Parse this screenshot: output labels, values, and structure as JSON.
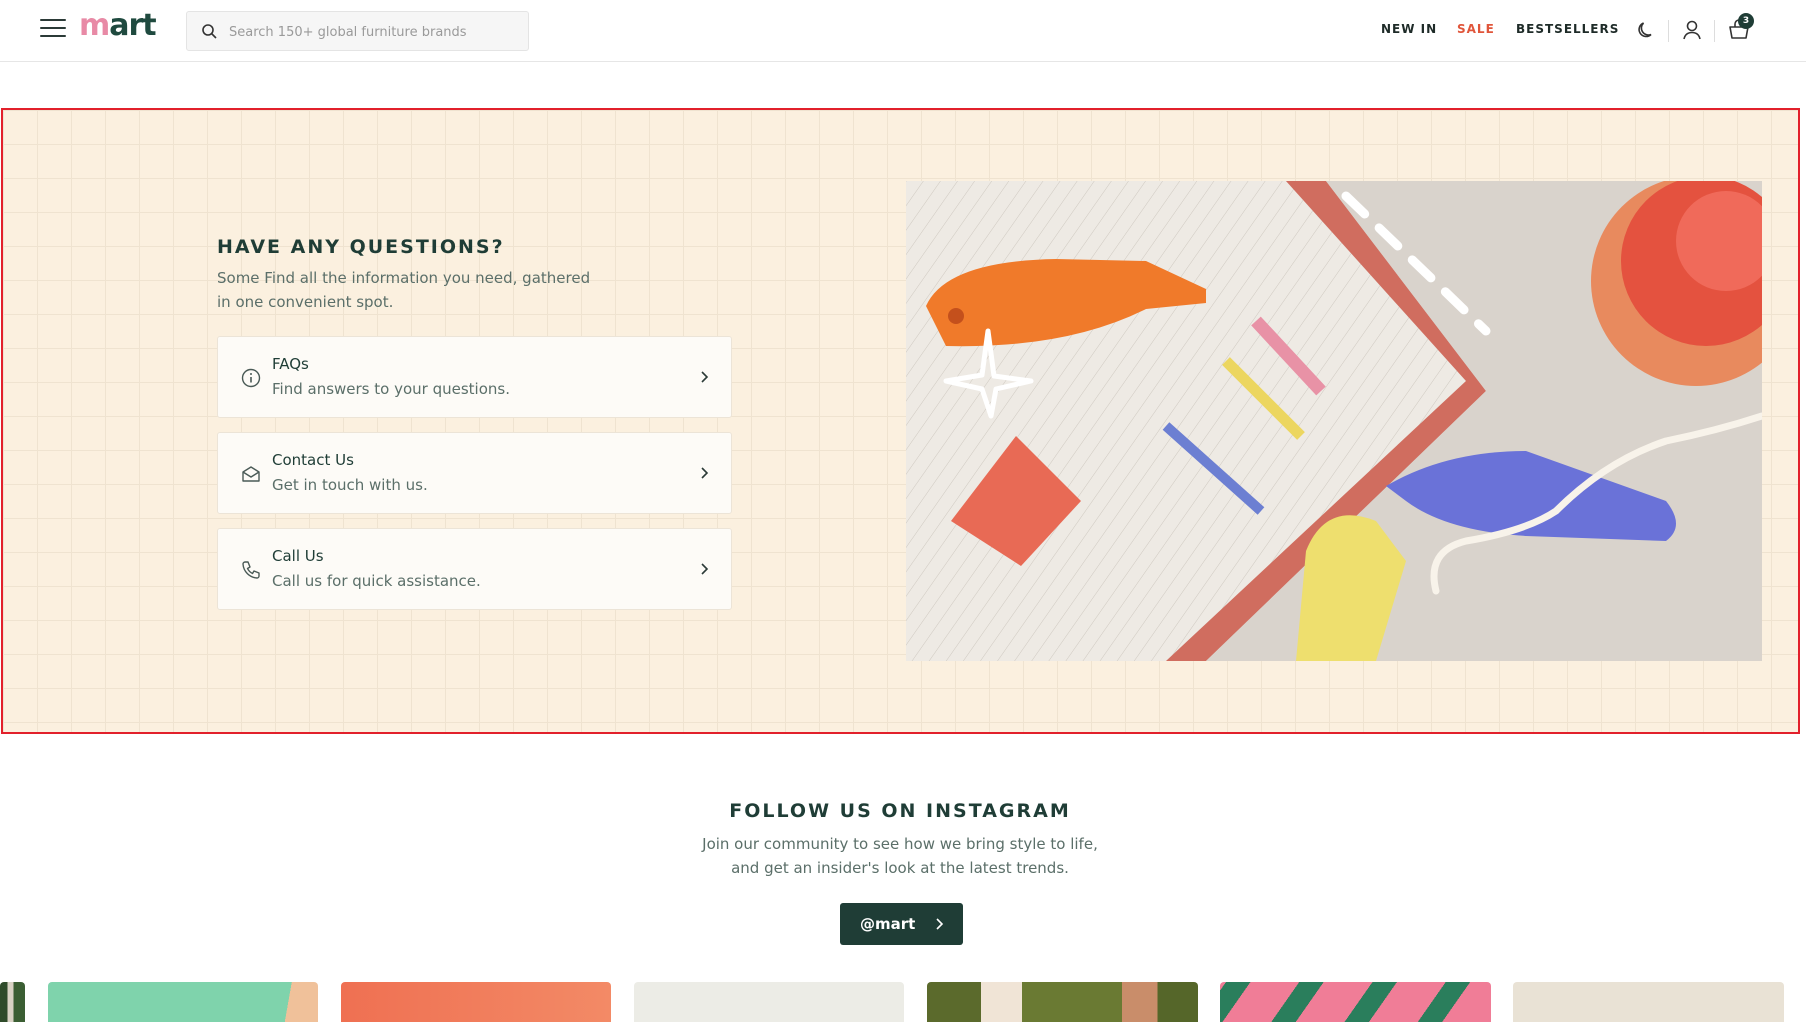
{
  "header": {
    "logo_m": "m",
    "logo_rest": "art",
    "search_placeholder": "Search 150+ global furniture brands",
    "nav": {
      "new_in": "NEW IN",
      "sale": "SALE",
      "bestsellers": "BESTSELLERS"
    },
    "cart_count": "3",
    "icons": [
      "menu-icon",
      "search-icon",
      "moon-icon",
      "user-icon",
      "cart-icon"
    ]
  },
  "questions": {
    "title": "HAVE ANY QUESTIONS?",
    "description": "Some Find all the information you need, gathered in one convenient spot.",
    "cards": [
      {
        "title": "FAQs",
        "subtitle": "Find answers to your questions.",
        "icon": "info-icon"
      },
      {
        "title": "Contact Us",
        "subtitle": "Get in touch with us.",
        "icon": "envelope-icon"
      },
      {
        "title": "Call Us",
        "subtitle": "Call us for quick assistance.",
        "icon": "phone-icon"
      }
    ]
  },
  "instagram": {
    "title": "FOLLOW US ON INSTAGRAM",
    "description": "Join our community to see how we bring style to life, and get an insider's look at the latest trends.",
    "button_label": "@mart"
  },
  "colors": {
    "brand_dark": "#1f3d36",
    "brand_pink": "#e88aa6",
    "sale": "#e0553a",
    "section_bg": "#fbf0df",
    "highlight_border": "#e2202b"
  }
}
